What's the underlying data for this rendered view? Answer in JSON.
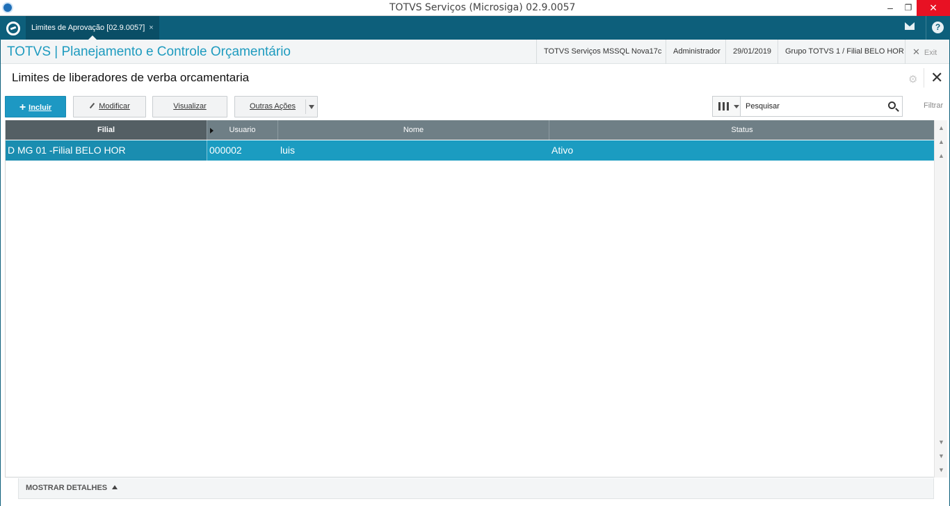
{
  "window": {
    "title": "TOTVS Serviços (Microsiga) 02.9.0057",
    "minimize": "–",
    "maximize": "❐",
    "close": "✕"
  },
  "tabbar": {
    "tab_label": "Limites de Aprovação [02.9.0057]",
    "tab_close": "×",
    "help_label": "?"
  },
  "header": {
    "app_title": "TOTVS | Planejamento e Controle Orçamentário",
    "environment": "TOTVS Serviços MSSQL Nova17c",
    "user": "Administrador",
    "date": "29/01/2019",
    "branch": "Grupo TOTVS 1 / Filial BELO HOR",
    "exit_label": "Exit"
  },
  "page": {
    "title": "Limites de liberadores de verba orcamentaria"
  },
  "toolbar": {
    "incluir_label": "Incluir",
    "modificar_label": "Modificar",
    "visualizar_label": "Visualizar",
    "outras_acoes_label": "Outras Ações"
  },
  "search": {
    "placeholder": "Pesquisar",
    "filter_label": "Filtrar"
  },
  "grid": {
    "columns": [
      "Filial",
      "Usuario",
      "Nome",
      "Status"
    ],
    "rows": [
      [
        "D MG 01 -Filial BELO HOR",
        "000002",
        "luis",
        "Ativo"
      ]
    ]
  },
  "details": {
    "label": "MOSTRAR DETALHES"
  },
  "colors": {
    "tabbar": "#0d5f7b",
    "accent": "#1e9bbf",
    "selected_row": "#1b9cc1",
    "grid_header": "#6f7f86"
  }
}
